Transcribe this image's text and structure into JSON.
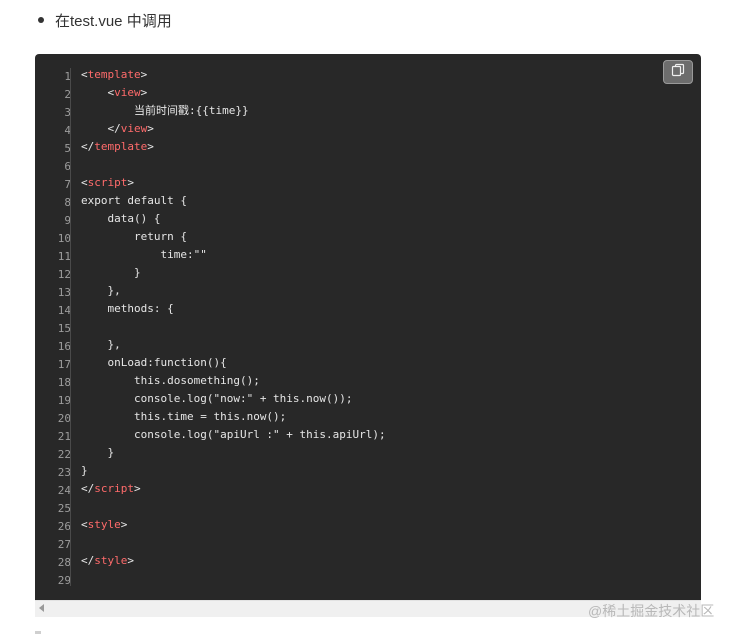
{
  "heading": {
    "text": "在test.vue 中调用"
  },
  "code": {
    "line_numbers": [
      "1",
      "2",
      "3",
      "4",
      "5",
      "6",
      "7",
      "8",
      "9",
      "10",
      "11",
      "12",
      "13",
      "14",
      "15",
      "16",
      "17",
      "18",
      "19",
      "20",
      "21",
      "22",
      "23",
      "24",
      "25",
      "26",
      "27",
      "28",
      "29"
    ],
    "lines": [
      {
        "indent": "",
        "open": "<",
        "tag": "template",
        "close": ">",
        "text": ""
      },
      {
        "indent": "    ",
        "open": "<",
        "tag": "view",
        "close": ">",
        "text": ""
      },
      {
        "indent": "        ",
        "open": "",
        "tag": "",
        "close": "",
        "text": "当前时间戳:{{time}}"
      },
      {
        "indent": "    ",
        "open": "</",
        "tag": "view",
        "close": ">",
        "text": ""
      },
      {
        "indent": "",
        "open": "</",
        "tag": "template",
        "close": ">",
        "text": ""
      },
      {
        "indent": "",
        "open": "",
        "tag": "",
        "close": "",
        "text": ""
      },
      {
        "indent": "",
        "open": "<",
        "tag": "script",
        "close": ">",
        "text": ""
      },
      {
        "indent": "",
        "open": "",
        "tag": "",
        "close": "",
        "text": "export default {"
      },
      {
        "indent": "    ",
        "open": "",
        "tag": "",
        "close": "",
        "text": "data() {"
      },
      {
        "indent": "        ",
        "open": "",
        "tag": "",
        "close": "",
        "text": "return {"
      },
      {
        "indent": "            ",
        "open": "",
        "tag": "",
        "close": "",
        "text": "time:\"\""
      },
      {
        "indent": "        ",
        "open": "",
        "tag": "",
        "close": "",
        "text": "}"
      },
      {
        "indent": "    ",
        "open": "",
        "tag": "",
        "close": "",
        "text": "},"
      },
      {
        "indent": "    ",
        "open": "",
        "tag": "",
        "close": "",
        "text": "methods: {"
      },
      {
        "indent": "",
        "open": "",
        "tag": "",
        "close": "",
        "text": ""
      },
      {
        "indent": "    ",
        "open": "",
        "tag": "",
        "close": "",
        "text": "},"
      },
      {
        "indent": "    ",
        "open": "",
        "tag": "",
        "close": "",
        "text": "onLoad:function(){"
      },
      {
        "indent": "        ",
        "open": "",
        "tag": "",
        "close": "",
        "text": "this.dosomething();"
      },
      {
        "indent": "        ",
        "open": "",
        "tag": "",
        "close": "",
        "text": "console.log(\"now:\" + this.now());"
      },
      {
        "indent": "        ",
        "open": "",
        "tag": "",
        "close": "",
        "text": "this.time = this.now();"
      },
      {
        "indent": "        ",
        "open": "",
        "tag": "",
        "close": "",
        "text": "console.log(\"apiUrl :\" + this.apiUrl);"
      },
      {
        "indent": "    ",
        "open": "",
        "tag": "",
        "close": "",
        "text": "}"
      },
      {
        "indent": "",
        "open": "",
        "tag": "",
        "close": "",
        "text": "}"
      },
      {
        "indent": "",
        "open": "</",
        "tag": "script",
        "close": ">",
        "text": ""
      },
      {
        "indent": "",
        "open": "",
        "tag": "",
        "close": "",
        "text": ""
      },
      {
        "indent": "",
        "open": "<",
        "tag": "style",
        "close": ">",
        "text": ""
      },
      {
        "indent": "",
        "open": "",
        "tag": "",
        "close": "",
        "text": ""
      },
      {
        "indent": "",
        "open": "</",
        "tag": "style",
        "close": ">",
        "text": ""
      },
      {
        "indent": "",
        "open": "",
        "tag": "",
        "close": "",
        "text": ""
      }
    ]
  },
  "copy_button": {
    "icon": "copy-icon"
  },
  "watermark": {
    "text": "@稀土掘金技术社区"
  },
  "colors": {
    "code_bg": "#282828",
    "code_text": "#e6e6e6",
    "tag": "#ff6b6b",
    "line_number": "#9d9d9d"
  }
}
